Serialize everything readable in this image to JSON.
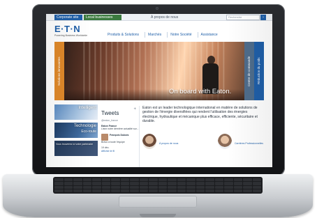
{
  "browser_top": {
    "tab_primary": "Corporate site",
    "tab_secondary": "Local businesses",
    "link": "À propos de nous",
    "search_placeholder": "Recherche",
    "search_button": "›"
  },
  "header": {
    "logo": "E·T·N",
    "tagline": "Powering Business Worldwide",
    "nav": [
      "Produits & Solutions",
      "Marchés",
      "Notre Société",
      "Assistance"
    ]
  },
  "hero": {
    "caption": "On board with Eaton.",
    "left_band": "Solutions innovantes",
    "right_band_1": "Centre de commande",
    "right_band_2": "Réduction du poids"
  },
  "tiles": [
    {
      "label": "Intelligent",
      "sub": ""
    },
    {
      "label": "Technologie",
      "sub": "Eco-route"
    },
    {
      "label": "Vous trouverez ici votre partenaire",
      "sub": ""
    }
  ],
  "tweets": {
    "title": "Tweets",
    "handle": "@eaton_france",
    "follow": "+",
    "items": [
      {
        "name": "Eaton France",
        "text": "Lisez notre dernière actualité sur..."
      },
      {
        "name": "François Dubois",
        "text": "Bravo à toute l'équipe"
      }
    ],
    "footer": "19 déc.",
    "footer_link": "Afficher le fil"
  },
  "about": {
    "text": "Eaton est un leader technologique international en matière de solutions de gestion de l'énergie diversifiées qui rendent l'utilisation des énergies électrique, hydraulique et mécanique plus efficace, efficiente, sécuritaire et durable.",
    "icon_1_caption": "À propos de nous",
    "icon_2_caption": "Carrières Professionnelles"
  }
}
